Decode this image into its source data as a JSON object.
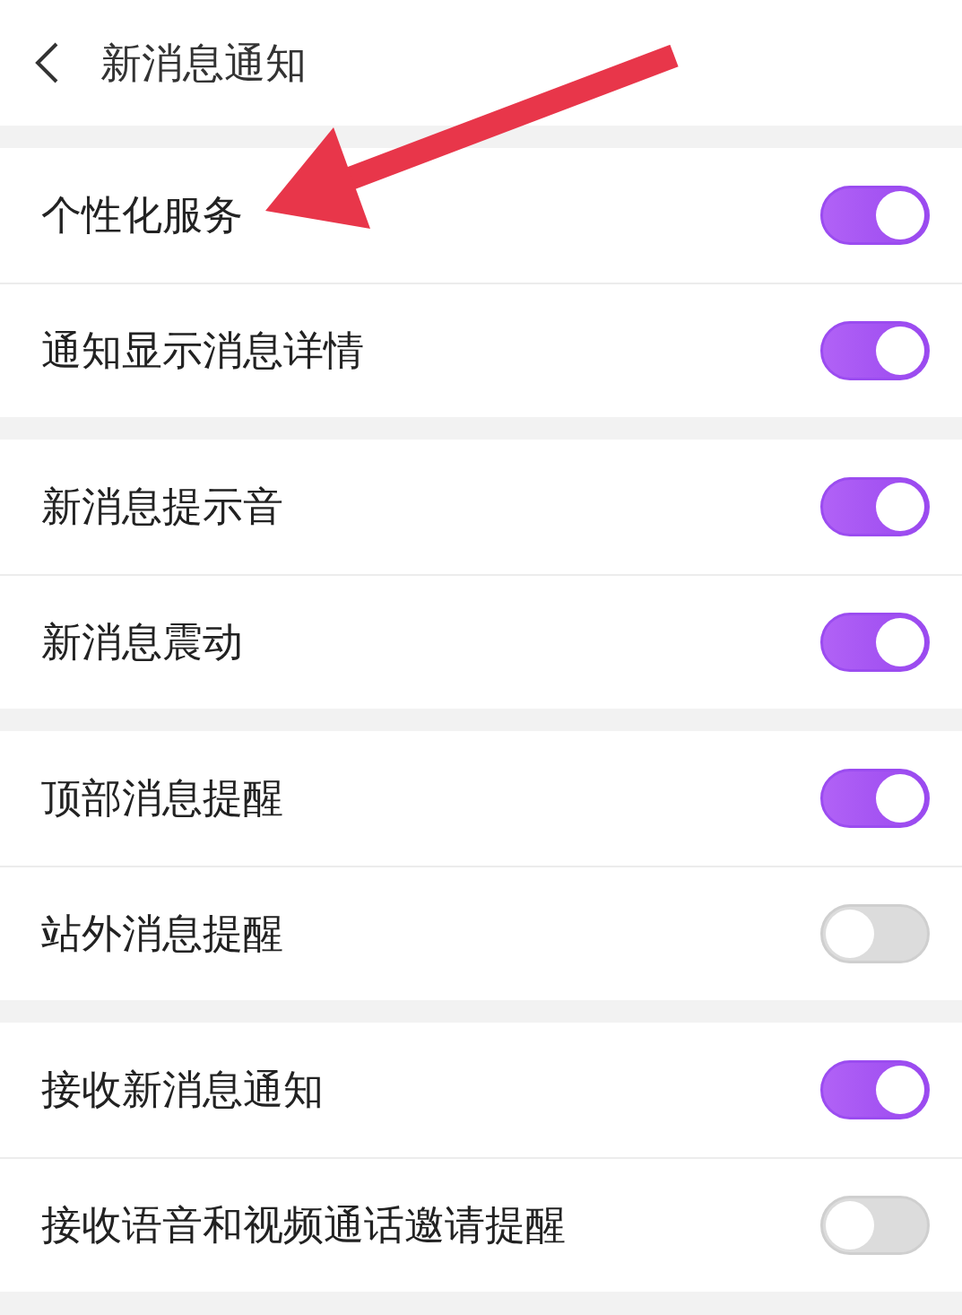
{
  "header": {
    "title": "新消息通知"
  },
  "groups": [
    {
      "items": [
        {
          "label": "个性化服务",
          "on": true
        },
        {
          "label": "通知显示消息详情",
          "on": true
        }
      ]
    },
    {
      "items": [
        {
          "label": "新消息提示音",
          "on": true
        },
        {
          "label": "新消息震动",
          "on": true
        }
      ]
    },
    {
      "items": [
        {
          "label": "顶部消息提醒",
          "on": true
        },
        {
          "label": "站外消息提醒",
          "on": false
        }
      ]
    },
    {
      "items": [
        {
          "label": "接收新消息通知",
          "on": true
        },
        {
          "label": "接收语音和视频通话邀请提醒",
          "on": false
        }
      ]
    }
  ]
}
